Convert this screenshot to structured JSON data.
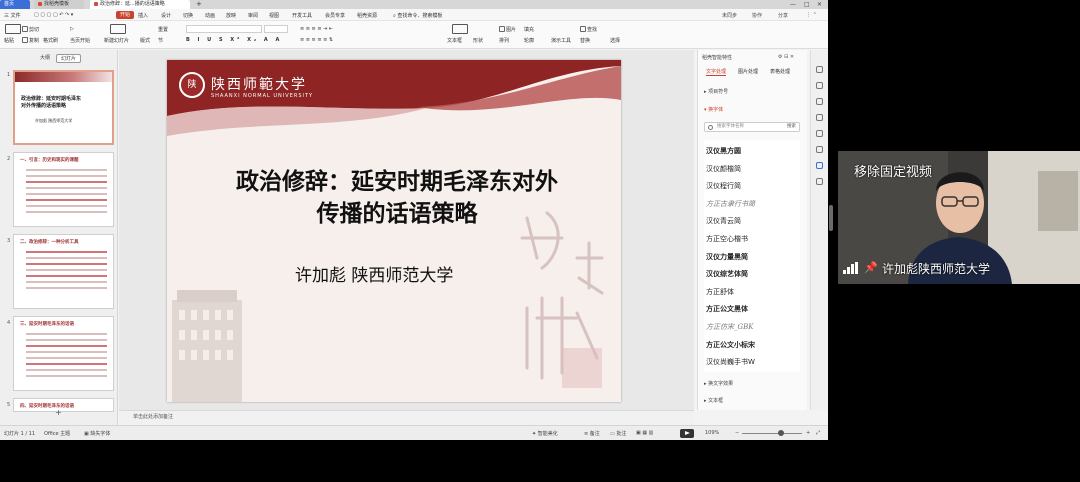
{
  "tabs": {
    "home": "首页",
    "doc1": "找稻壳模板",
    "doc2": "政治修辞：延...播的话语策略",
    "add": "+"
  },
  "menu": {
    "file": "三 文件",
    "items": [
      "开始",
      "插入",
      "设计",
      "切换",
      "动画",
      "放映",
      "审阅",
      "视图",
      "开发工具",
      "会员专享",
      "稻壳资源"
    ],
    "active_index": 0,
    "search": "查找命令、搜索模板",
    "right": [
      "未同步",
      "协作",
      "分享"
    ]
  },
  "toolbar": {
    "paste": "粘贴",
    "cut": "剪切",
    "copy": "复制",
    "format_painter": "格式刷",
    "start_from": "当页开始",
    "new_slide": "新建幻灯片",
    "layout": "版式",
    "section": "节",
    "reset": "重置",
    "text_box": "文本框",
    "shape": "形状",
    "arrange": "排列",
    "outline": "轮廓",
    "picture": "图片",
    "fill": "填充",
    "find": "查找",
    "replace": "替换",
    "select": "选择",
    "format_convert": "格式转换",
    "presenter": "演示工具"
  },
  "thumbnails": {
    "tabs": [
      "大纲",
      "幻灯片"
    ],
    "active_tab": 1,
    "slides": [
      {
        "num": "1",
        "title": "政治修辞：延安时期毛泽东对外传播的话语策略",
        "author": "许加彪 陕西师范大学"
      },
      {
        "num": "2",
        "title": "一、引言：历史和现实的课题"
      },
      {
        "num": "3",
        "title": "二、政治修辞：一种分析工具"
      },
      {
        "num": "4",
        "title": "三、延安时期毛泽东的话语"
      },
      {
        "num": "5",
        "title": "四、延安时期毛泽东的话语"
      }
    ]
  },
  "slide": {
    "university_cn": "陕西师範大学",
    "university_en": "SHAANXI NORMAL UNIVERSITY",
    "logo_char": "陕",
    "title_line1": "政治修辞：延安时期毛泽东对外",
    "title_line2": "传播的话语策略",
    "author": "许加彪  陕西师范大学"
  },
  "notes_placeholder": "单击此处添加备注",
  "pane": {
    "title": "稻壳智能特性",
    "tabs": [
      "文字处理",
      "图片处理",
      "表格处理"
    ],
    "active_tab": 0,
    "section_symbols": "项目符号",
    "section_font": "换字体",
    "search_placeholder": "搜索字体名称",
    "search_button": "搜索",
    "fonts": [
      "汉仪黑方圆",
      "汉仪颜楷简",
      "汉仪程行简",
      "方正古隶行书简",
      "汉仪青云简",
      "方正空心楷书",
      "汉仪力量黑简",
      "汉仪综艺体简",
      "方正舒体",
      "方正公文黑体",
      "方正仿宋_GBK",
      "方正公文小标宋",
      "汉仪尚巍手书W"
    ],
    "bold_fonts": [
      0,
      6,
      7,
      9,
      11
    ],
    "light_fonts": [
      3,
      10
    ],
    "section_effects": "换文字效果",
    "section_textbox": "文本框"
  },
  "status": {
    "slide_count": "幻灯片 1 / 11",
    "theme": "Office 主题",
    "missing_font": "缺失字体",
    "smart_beautify": "智能美化",
    "notes": "备注",
    "comments": "批注",
    "zoom": "109%"
  },
  "video": {
    "unpin": "移除固定视频",
    "name": "许加彪陕西师范大学"
  }
}
